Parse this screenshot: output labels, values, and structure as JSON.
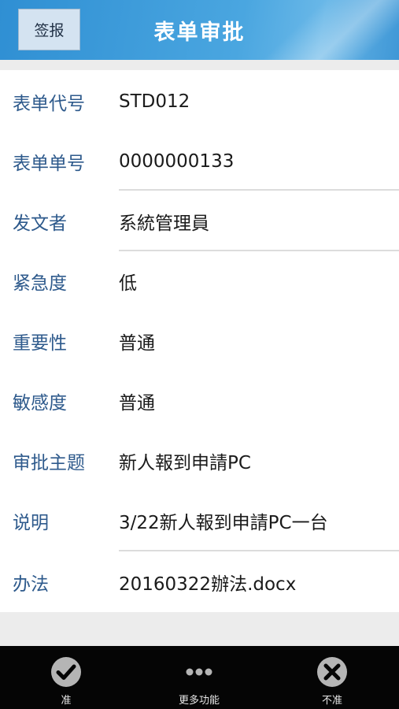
{
  "header": {
    "sign_button": "签报",
    "title": "表单审批"
  },
  "form": {
    "fields": [
      {
        "label": "表单代号",
        "value": "STD012"
      },
      {
        "label": "表单单号",
        "value": "0000000133"
      },
      {
        "label": "发文者",
        "value": "系統管理員"
      },
      {
        "label": "紧急度",
        "value": "低"
      },
      {
        "label": "重要性",
        "value": "普通"
      },
      {
        "label": "敏感度",
        "value": "普通"
      },
      {
        "label": "审批主题",
        "value": "新人報到申請PC"
      },
      {
        "label": "说明",
        "value": "3/22新人報到申請PC一台"
      },
      {
        "label": "办法",
        "value": "20160322辦法.docx"
      }
    ]
  },
  "bottom_bar": {
    "approve": {
      "label": "准",
      "icon": "check-circle-icon"
    },
    "more": {
      "label": "更多功能",
      "icon": "more-dots-icon"
    },
    "reject": {
      "label": "不准",
      "icon": "x-circle-icon"
    }
  }
}
